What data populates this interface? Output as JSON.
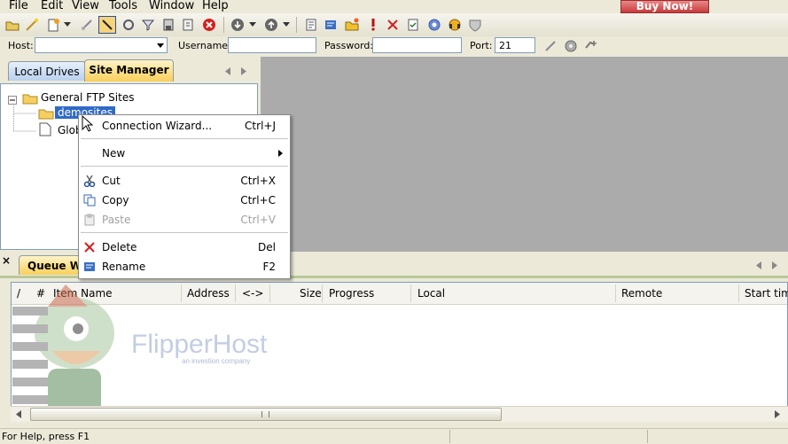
{
  "menu": {
    "items": [
      {
        "label": "File"
      },
      {
        "label": "Edit"
      },
      {
        "label": "View"
      },
      {
        "label": "Tools"
      },
      {
        "label": "Window"
      },
      {
        "label": "Help"
      }
    ],
    "buy_now": "Buy Now!"
  },
  "toolbar": {
    "icons": [
      "open-icon",
      "wand-icon",
      "new-site-icon",
      "dropdown-arrow",
      "disconnect-icon",
      "select-icon",
      "refresh-icon",
      "filter-icon",
      "save-icon",
      "stop-icon",
      "cancel-icon",
      "download-icon",
      "download-arrow",
      "upload-icon",
      "upload-arrow",
      "properties-icon",
      "rename-icon",
      "new-folder-icon",
      "exclamation-icon",
      "delete-icon",
      "check-icon",
      "settings-icon",
      "support-icon",
      "shield-icon"
    ]
  },
  "quickconnect": {
    "host_label": "Host:",
    "host_value": "",
    "username_label": "Username:",
    "username_value": "",
    "password_label": "Password:",
    "password_value": "",
    "port_label": "Port:",
    "port_value": "21"
  },
  "left_panel": {
    "tabs": [
      {
        "label": "Local Drives"
      },
      {
        "label": "Site Manager"
      }
    ],
    "tree": {
      "root": "General FTP Sites",
      "child1": "demosites",
      "child2": "Glob"
    }
  },
  "context_menu": {
    "items": [
      {
        "label": "Connection Wizard...",
        "shortcut": "Ctrl+J"
      },
      {
        "label": "New",
        "shortcut": ""
      },
      {
        "label": "Cut",
        "shortcut": "Ctrl+X"
      },
      {
        "label": "Copy",
        "shortcut": "Ctrl+C"
      },
      {
        "label": "Paste",
        "shortcut": "Ctrl+V"
      },
      {
        "label": "Delete",
        "shortcut": "Del"
      },
      {
        "label": "Rename",
        "shortcut": "F2"
      }
    ]
  },
  "queue": {
    "tab_label": "Queue Wi",
    "close_x": "×",
    "columns": [
      "/",
      "#",
      "Item Name",
      "Address",
      "<->",
      "Size",
      "Progress",
      "Local",
      "Remote",
      "Start tim"
    ]
  },
  "watermark": {
    "brand": "FlipperHost",
    "tagline": "an investion company"
  },
  "statusbar": {
    "text": "For Help, press F1"
  }
}
